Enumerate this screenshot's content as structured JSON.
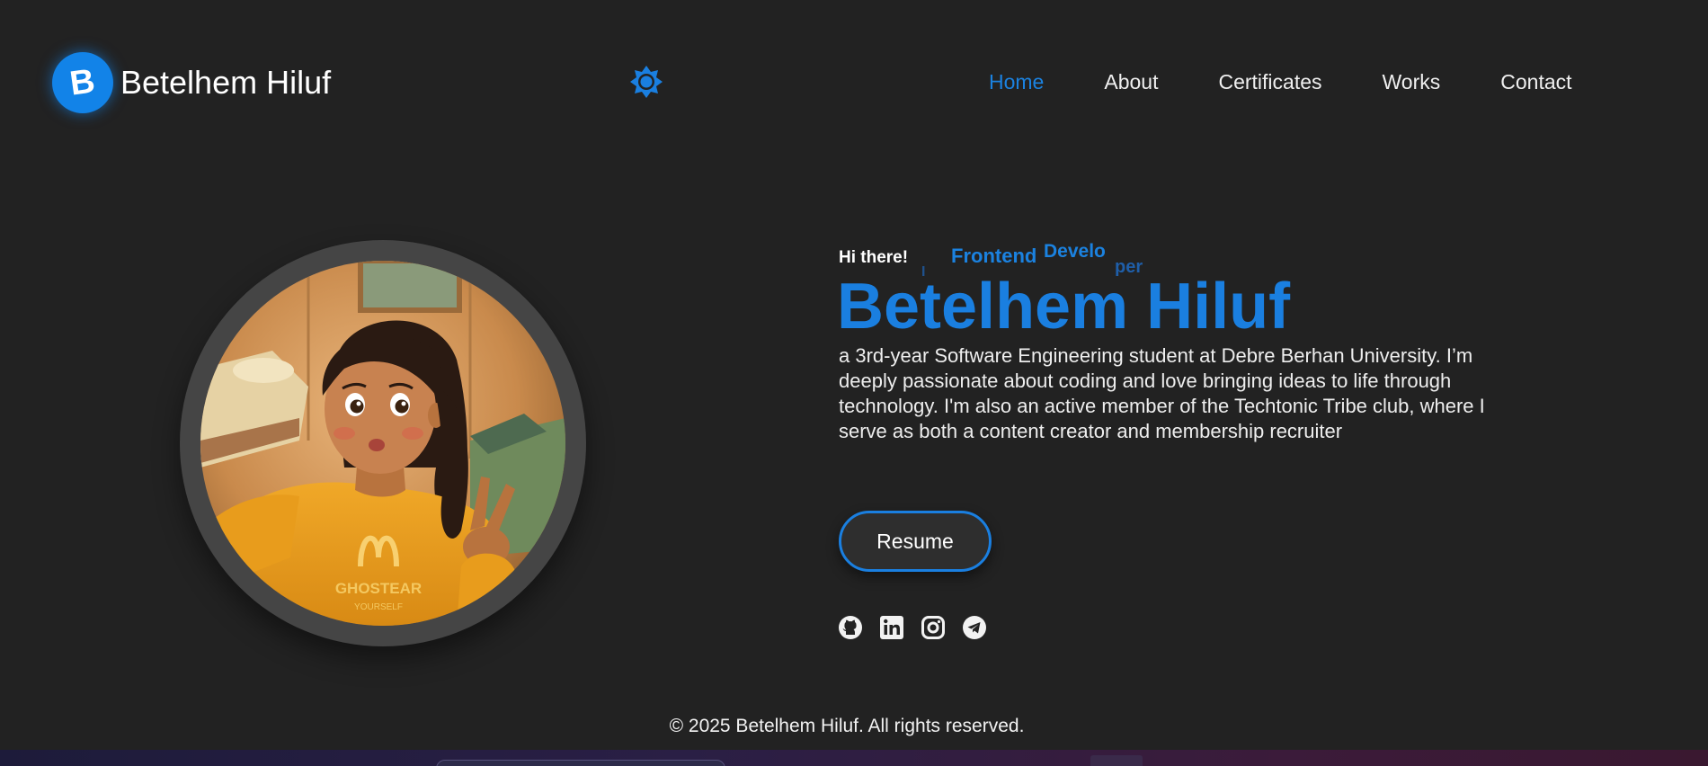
{
  "header": {
    "logo_letter": "B",
    "brand_name": "Betelhem Hiluf",
    "theme_icon": "sun-gear-icon",
    "nav": [
      {
        "label": "Home",
        "active": true
      },
      {
        "label": "About",
        "active": false
      },
      {
        "label": "Certificates",
        "active": false
      },
      {
        "label": "Works",
        "active": false
      },
      {
        "label": "Contact",
        "active": false
      }
    ]
  },
  "hero": {
    "greeting": "Hi there!",
    "role_fragments": [
      "I",
      "Frontend",
      "Develo",
      "per"
    ],
    "name": "Betelhem Hiluf",
    "bio": "a 3rd-year Software Engineering student at Debre Berhan University. I’m deeply passionate about coding and love bringing ideas to life through technology. I'm also an active member of the Techtonic Tribe club, where I serve as both a content creator and membership recruiter",
    "resume_label": "Resume",
    "socials": [
      "github-icon",
      "linkedin-icon",
      "instagram-icon",
      "telegram-icon"
    ],
    "avatar_alt": "profile-illustration"
  },
  "footer": {
    "text": "© 2025 Betelhem Hiluf. All rights reserved."
  },
  "colors": {
    "background": "#222222",
    "accent": "#1a7fe0",
    "text": "#f2f2f2",
    "avatar_ring": "#454545"
  }
}
